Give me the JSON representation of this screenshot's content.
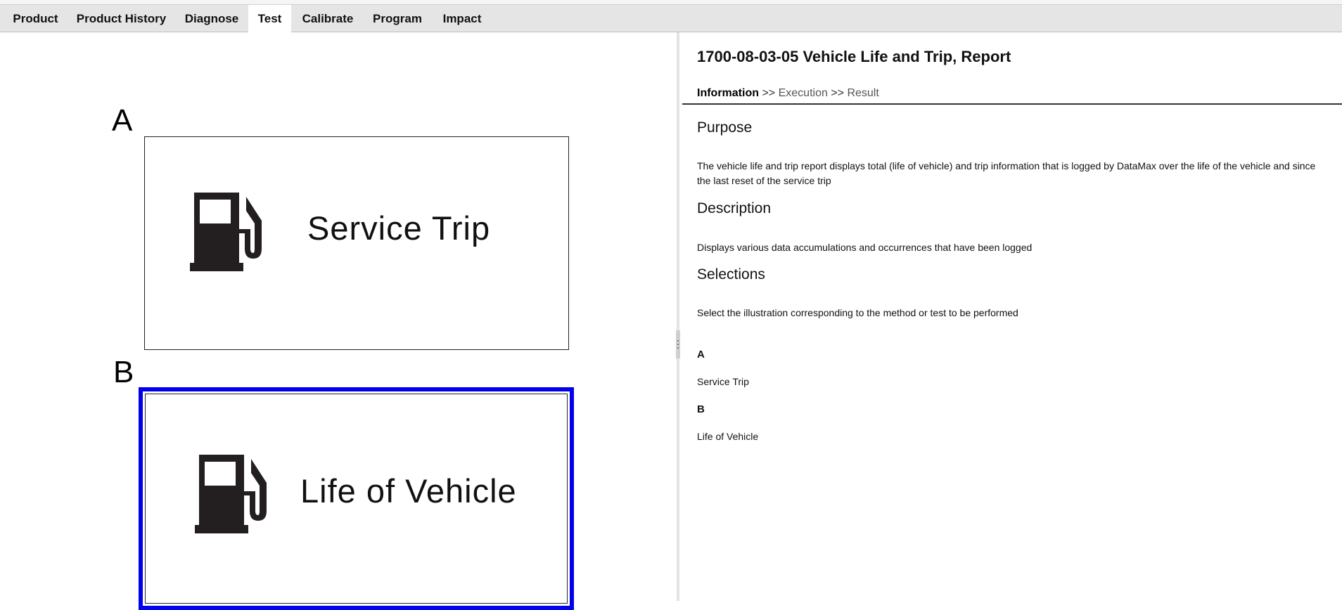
{
  "tabs": [
    {
      "label": "Product",
      "active": false
    },
    {
      "label": "Product History",
      "active": false
    },
    {
      "label": "Diagnose",
      "active": false
    },
    {
      "label": "Test",
      "active": true
    },
    {
      "label": "Calibrate",
      "active": false
    },
    {
      "label": "Program",
      "active": false
    },
    {
      "label": "Impact",
      "active": false
    }
  ],
  "selections": {
    "a": {
      "letter": "A",
      "label": "Service Trip",
      "icon": "fuel-pump-icon",
      "selected": false
    },
    "b": {
      "letter": "B",
      "label": "Life of Vehicle",
      "icon": "fuel-pump-icon",
      "selected": true
    }
  },
  "colors": {
    "selected_border": "#0000ee",
    "active_tab": "#ffffff",
    "tab_bar": "#e5e5e5"
  },
  "doc": {
    "title": "1700-08-03-05 Vehicle Life and Trip, Report",
    "breadcrumb": {
      "step1": "Information",
      "step2": "Execution",
      "step3": "Result",
      "separator": ">>"
    },
    "purpose": {
      "heading": "Purpose",
      "text": "The vehicle life and trip report displays total (life of vehicle) and trip information that is logged by DataMax over the life of the vehicle and since the last reset of the service trip"
    },
    "description": {
      "heading": "Description",
      "text": "Displays various data accumulations and occurrences that have been logged"
    },
    "selections": {
      "heading": "Selections",
      "text": "Select the illustration corresponding to the method or test to be performed",
      "items": [
        {
          "key": "A",
          "value": "Service Trip"
        },
        {
          "key": "B",
          "value": "Life of Vehicle"
        }
      ]
    }
  }
}
